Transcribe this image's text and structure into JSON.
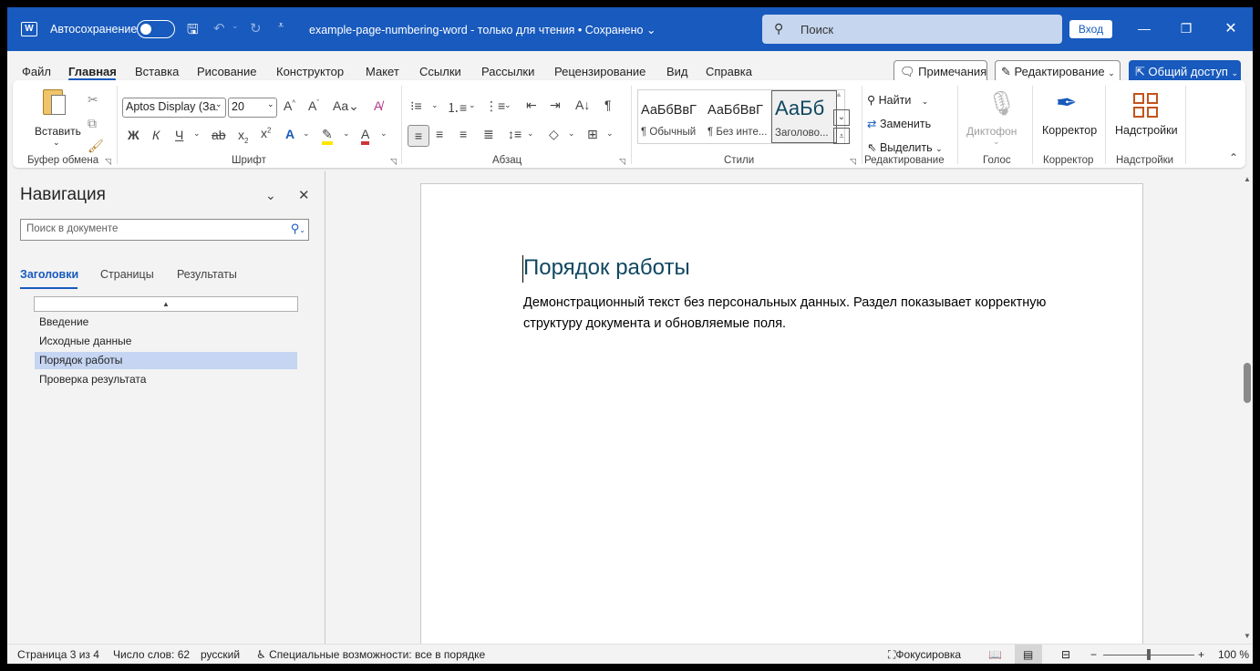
{
  "titlebar": {
    "autosave_label": "Автосохранение",
    "document_title": "example-page-numbering-word  -  только для чтения • Сохранено",
    "search_placeholder": "Поиск",
    "signin_label": "Вход"
  },
  "menu": {
    "items": [
      "Файл",
      "Главная",
      "Вставка",
      "Рисование",
      "Конструктор",
      "Макет",
      "Ссылки",
      "Рассылки",
      "Рецензирование",
      "Вид",
      "Справка"
    ],
    "active_index": 1,
    "comments_label": "Примечания",
    "editing_label": "Редактирование",
    "share_label": "Общий доступ"
  },
  "ribbon": {
    "clipboard": {
      "paste_label": "Вставить",
      "group_label": "Буфер обмена"
    },
    "font": {
      "font_name": "Aptos Display (Заг",
      "font_size": "20",
      "group_label": "Шрифт",
      "bold": "Ж",
      "italic": "К",
      "underline": "Ч"
    },
    "paragraph": {
      "group_label": "Абзац"
    },
    "styles": {
      "group_label": "Стили",
      "items": [
        {
          "sample": "АаБбВвГ",
          "name": "¶ Обычный"
        },
        {
          "sample": "АаБбВвГ",
          "name": "¶ Без инте..."
        },
        {
          "sample": "АаБб",
          "name": "Заголово..."
        }
      ]
    },
    "editing": {
      "find_label": "Найти",
      "replace_label": "Заменить",
      "select_label": "Выделить",
      "group_label": "Редактирование"
    },
    "voice": {
      "dictate_label": "Диктофон",
      "group_label": "Голос"
    },
    "editor": {
      "label": "Корректор",
      "group_label": "Корректор"
    },
    "addins": {
      "label": "Надстройки",
      "group_label": "Надстройки"
    }
  },
  "navigation": {
    "title": "Навигация",
    "search_placeholder": "Поиск в документе",
    "tabs": [
      "Заголовки",
      "Страницы",
      "Результаты"
    ],
    "active_tab": 0,
    "headings": [
      "Введение",
      "Исходные данные",
      "Порядок работы",
      "Проверка результата"
    ],
    "selected_heading": 2
  },
  "document": {
    "heading": "Порядок работы",
    "body_line1": "Демонстрационный текст без персональных данных. Раздел показывает корректную",
    "body_line2": "структуру документа и обновляемые поля."
  },
  "status": {
    "page": "Страница 3 из 4",
    "words": "Число слов: 62",
    "language": "русский",
    "accessibility": "Специальные возможности: все в порядке",
    "focus": "Фокусировка",
    "zoom": "100 %",
    "zoom_percent": 100
  },
  "colors": {
    "brand": "#185abd",
    "heading": "#0f4761",
    "nav_selected": "#c5d5f2"
  }
}
